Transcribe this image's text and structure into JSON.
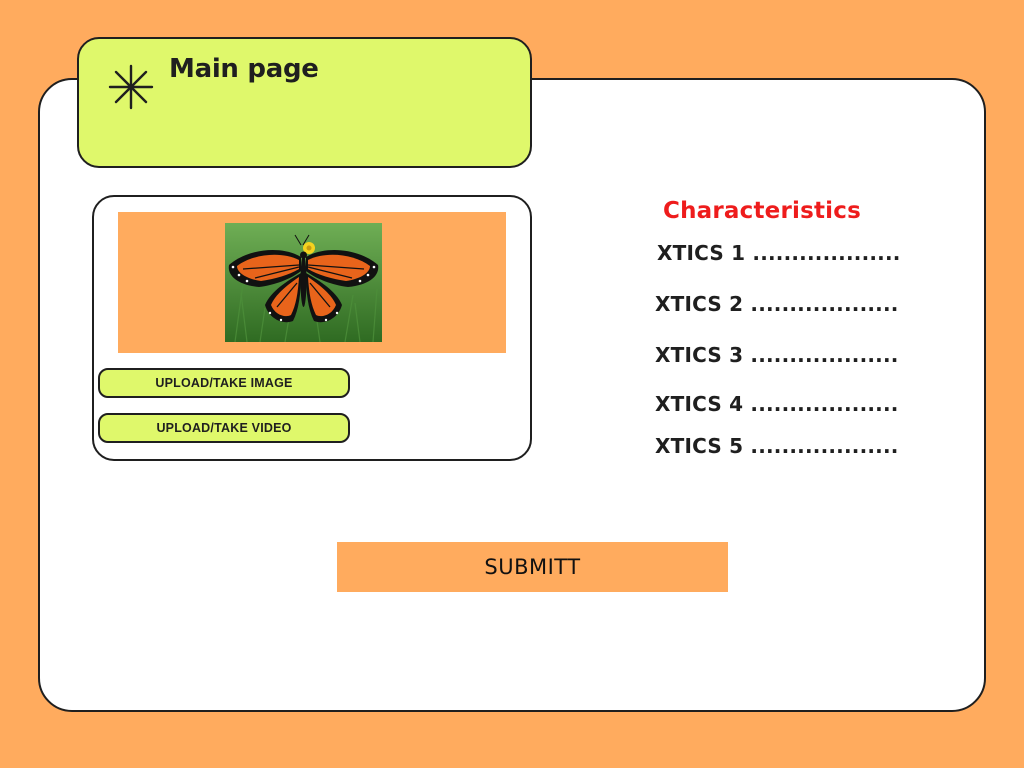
{
  "header": {
    "title": "Main page",
    "icon": "asterisk-icon"
  },
  "media": {
    "image_subject": "monarch-butterfly",
    "buttons": {
      "upload_image": "UPLOAD/TAKE IMAGE",
      "upload_video": "UPLOAD/TAKE VIDEO"
    }
  },
  "characteristics": {
    "title": "Characteristics",
    "items": [
      "XTICS 1 ...................",
      "XTICS 2 ...................",
      "XTICS 3 ...................",
      "XTICS 4 ...................",
      "XTICS 5 ..................."
    ]
  },
  "submit": {
    "label": "SUBMITT"
  },
  "colors": {
    "background": "#ffab5e",
    "accent_lime": "#dff86b",
    "heading_red": "#ee1c1c",
    "card": "#ffffff",
    "border": "#1f1f1f"
  }
}
